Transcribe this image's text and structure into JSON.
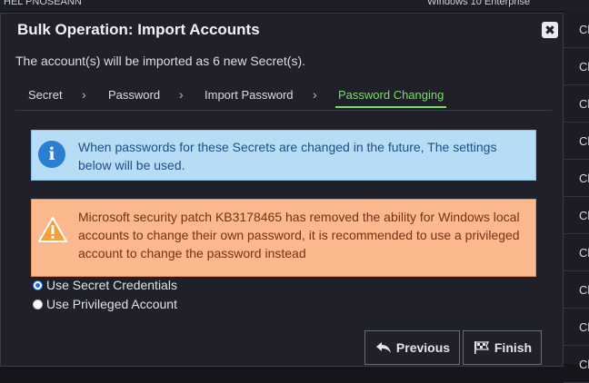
{
  "background": {
    "top_left_text": "HEL PNOSEANN",
    "top_right_text": "Windows 10 Enterprise",
    "column_rows": [
      "Cli",
      "Cli",
      "Cli",
      "Cli",
      "Cli",
      "Cli",
      "Cli",
      "Cli",
      "Cli",
      "Cli"
    ]
  },
  "modal": {
    "title": "Bulk Operation: Import Accounts",
    "close_label": "✖",
    "subtitle": "The account(s) will be imported as 6 new Secret(s).",
    "steps": [
      {
        "label": "Secret",
        "active": false
      },
      {
        "label": "Password",
        "active": false
      },
      {
        "label": "Import Password",
        "active": false
      },
      {
        "label": "Password Changing",
        "active": true
      }
    ],
    "info_alert": {
      "icon": "info-icon",
      "text": "When passwords for these Secrets are changed in the future, The settings below will be used."
    },
    "warning_alert": {
      "icon": "warning-icon",
      "text": "Microsoft security patch KB3178465 has removed the ability for Windows local accounts to change their own password, it is recommended to use a privileged account to change the password instead"
    },
    "options": [
      {
        "label": "Use Secret Credentials",
        "checked": true
      },
      {
        "label": "Use Privileged Account",
        "checked": false
      }
    ],
    "buttons": {
      "previous": "Previous",
      "finish": "Finish"
    },
    "colors": {
      "accent_green": "#7bdc6a",
      "info_bg": "#b6dcf6",
      "warn_bg": "#fbb98d"
    }
  }
}
